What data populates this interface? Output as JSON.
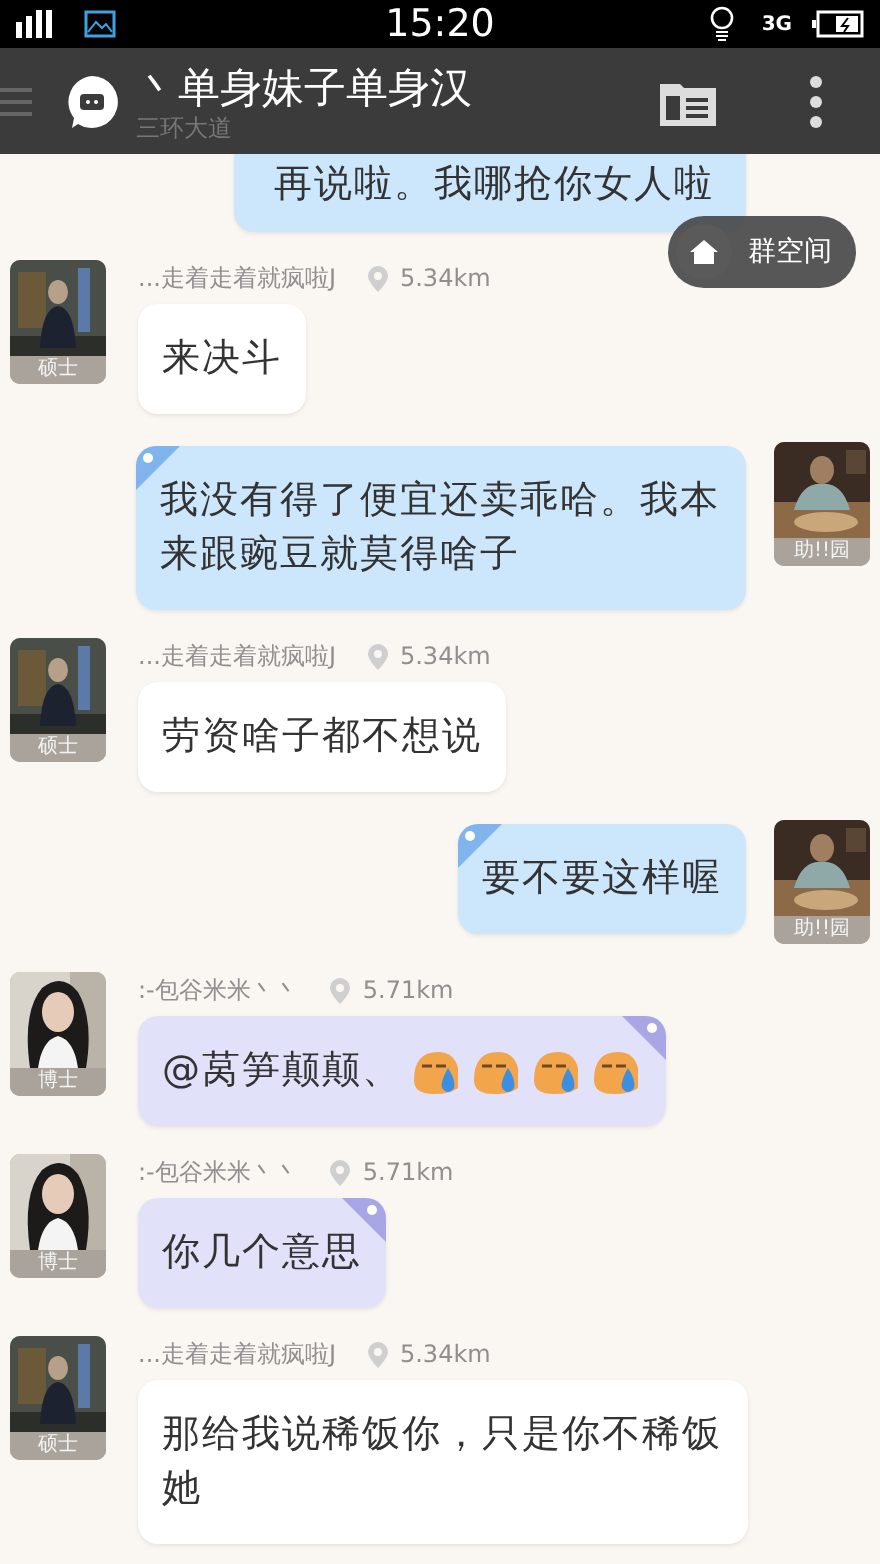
{
  "status_bar": {
    "time": "15:20",
    "network": "3G"
  },
  "header": {
    "title": "丶单身妹子单身汉",
    "subtitle": "三环大道"
  },
  "floating_button": {
    "label": "群空间"
  },
  "messages": [
    {
      "kind": "sent",
      "color": "#cce6fc",
      "ribbon": false,
      "text": "再说啦。我哪抢你女人啦"
    },
    {
      "kind": "received",
      "color": "#ffffff",
      "ribbon": false,
      "sender": "...走着走着就疯啦J",
      "distance": "5.34km",
      "badge": "硕士",
      "text": "来决斗"
    },
    {
      "kind": "sent",
      "color": "#cce6fc",
      "ribbon": true,
      "badge": "助!!园",
      "text": "我没有得了便宜还卖乖哈。我本来跟豌豆就莫得啥子"
    },
    {
      "kind": "received",
      "color": "#ffffff",
      "ribbon": false,
      "sender": "...走着走着就疯啦J",
      "distance": "5.34km",
      "badge": "硕士",
      "text": "劳资啥子都不想说"
    },
    {
      "kind": "sent",
      "color": "#cce6fc",
      "ribbon": true,
      "badge": "助!!园",
      "text": "要不要这样喔"
    },
    {
      "kind": "received",
      "color": "#e2e1fa",
      "ribbon": true,
      "sender": ":-包谷米米丶丶",
      "distance": "5.71km",
      "badge": "博士",
      "text": "@莴笋颠颠、",
      "emojis": [
        {
          "kind": "sweat"
        },
        {
          "kind": "sweat"
        },
        {
          "kind": "sweat"
        },
        {
          "kind": "sweat"
        }
      ]
    },
    {
      "kind": "received",
      "color": "#e2e1fa",
      "ribbon": true,
      "sender": ":-包谷米米丶丶",
      "distance": "5.71km",
      "badge": "博士",
      "text": "你几个意思"
    },
    {
      "kind": "received",
      "color": "#ffffff",
      "ribbon": false,
      "sender": "...走着走着就疯啦J",
      "distance": "5.34km",
      "badge": "硕士",
      "text": "那给我说稀饭你，只是你不稀饭她"
    }
  ]
}
